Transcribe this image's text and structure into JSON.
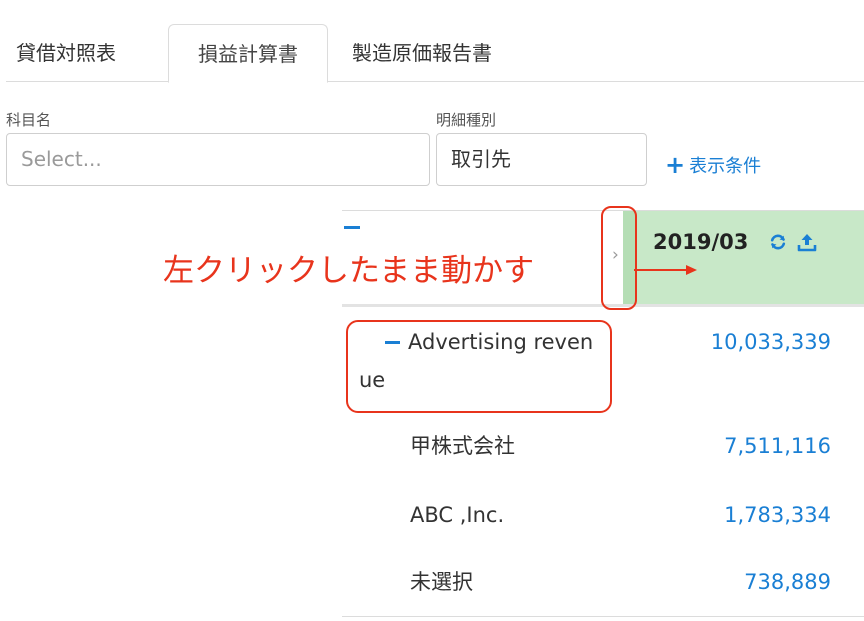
{
  "tabs": [
    {
      "label": "貸借対照表",
      "active": false
    },
    {
      "label": "損益計算書",
      "active": true
    },
    {
      "label": "製造原価報告書",
      "active": false
    }
  ],
  "filters": {
    "account_name_label": "科目名",
    "account_name_placeholder": "Select...",
    "detail_type_label": "明細種別",
    "detail_type_value": "取引先",
    "display_conditions_label": "表示条件"
  },
  "table": {
    "period": "2019/03",
    "rows": [
      {
        "label_line1": "Advertising reven",
        "label_line2": "ue",
        "value": "10,033,339"
      },
      {
        "label": "甲株式会社",
        "value": "7,511,116"
      },
      {
        "label": "ABC ,Inc.",
        "value": "1,783,334"
      },
      {
        "label": "未選択",
        "value": "738,889"
      }
    ]
  },
  "annotation": {
    "text": "左クリックしたまま動かす",
    "color": "#e8341c"
  },
  "colors": {
    "accent": "#1a7fd4",
    "period_header_bg": "#c8e8c8"
  },
  "icons": {
    "resize_handle": "›",
    "refresh": "refresh-icon",
    "upload": "upload-icon"
  }
}
